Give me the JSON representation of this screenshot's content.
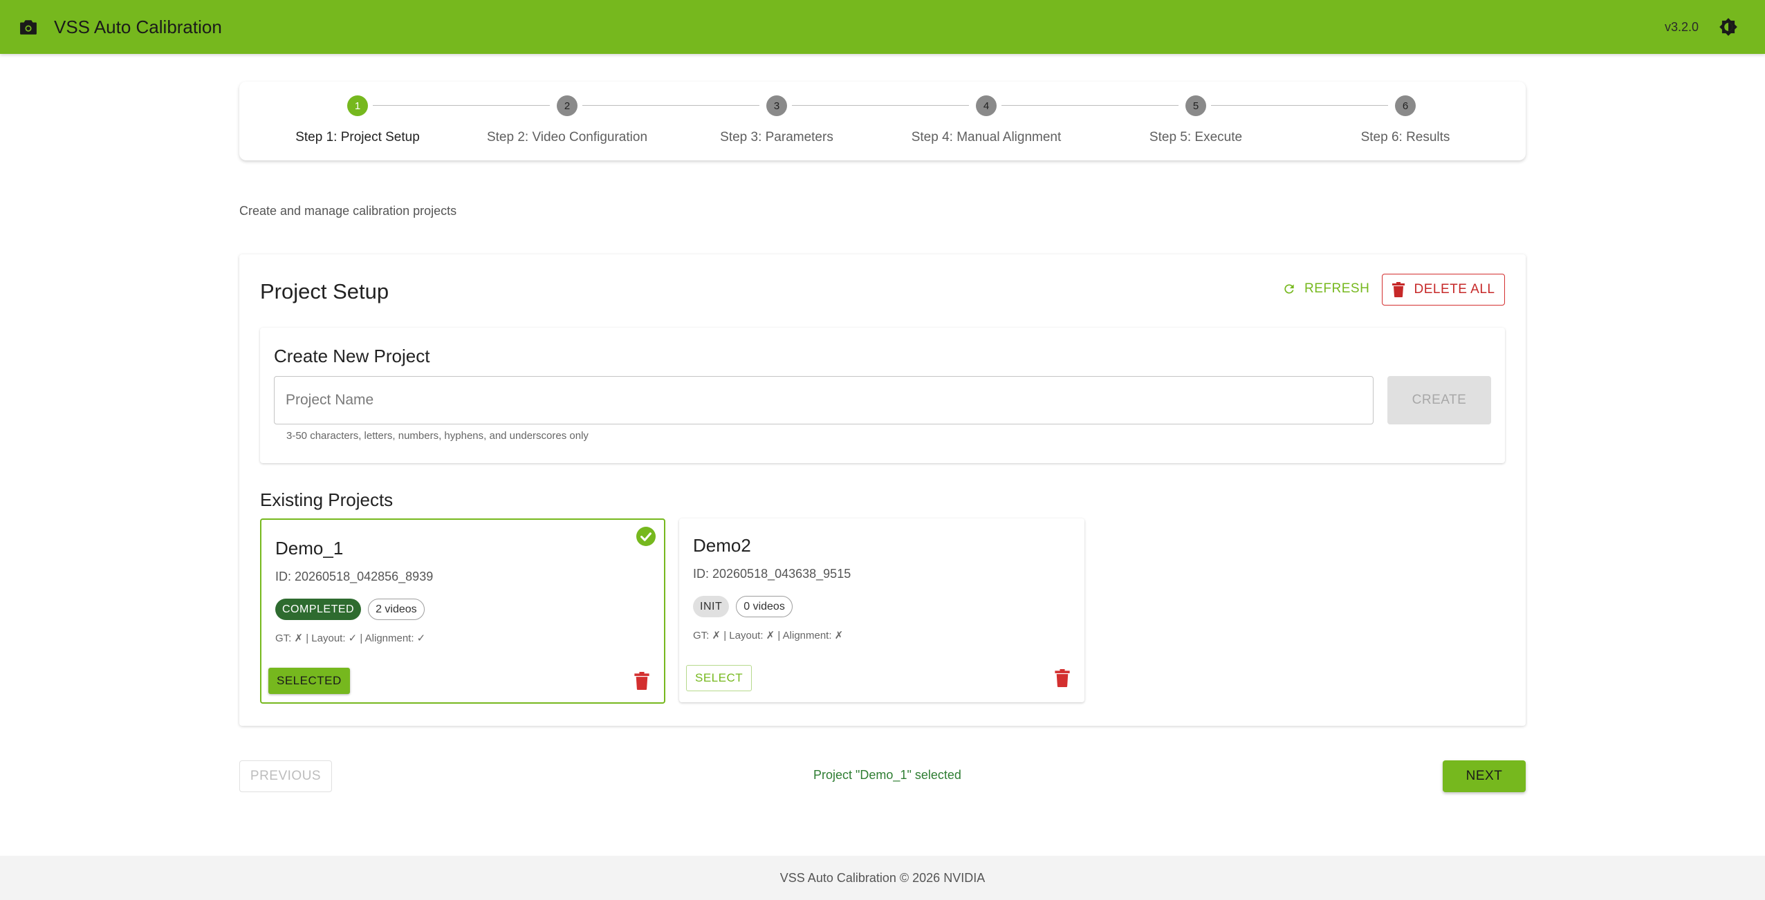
{
  "app": {
    "title": "VSS Auto Calibration",
    "version": "v3.2.0",
    "icons": {
      "logo": "camera-icon",
      "theme": "brightness-toggle-icon"
    },
    "colors": {
      "primary": "#76b81e",
      "danger": "#d32f2f",
      "completed": "#2e6b2f",
      "success_text": "#2e7d32"
    }
  },
  "stepper": {
    "active_step": 1,
    "steps": [
      {
        "number": "1",
        "label": "Step 1: Project Setup"
      },
      {
        "number": "2",
        "label": "Step 2: Video Configuration"
      },
      {
        "number": "3",
        "label": "Step 3: Parameters"
      },
      {
        "number": "4",
        "label": "Step 4: Manual Alignment"
      },
      {
        "number": "5",
        "label": "Step 5: Execute"
      },
      {
        "number": "6",
        "label": "Step 6: Results"
      }
    ]
  },
  "subtitle": "Create and manage calibration projects",
  "setup": {
    "title": "Project Setup",
    "refresh_label": "REFRESH",
    "delete_all_label": "DELETE ALL",
    "create": {
      "heading": "Create New Project",
      "name_value": "",
      "name_placeholder": "Project Name",
      "create_label": "CREATE",
      "helper": "3-50 characters, letters, numbers, hyphens, and underscores only"
    },
    "existing_heading": "Existing Projects",
    "projects": [
      {
        "name": "Demo_1",
        "id": "ID: 20260518_042856_8939",
        "status": "COMPLETED",
        "videos": "2 videos",
        "flags": "GT: ✗ | Layout: ✓ | Alignment: ✓",
        "button": "SELECTED",
        "selected": true
      },
      {
        "name": "Demo2",
        "id": "ID: 20260518_043638_9515",
        "status": "INIT",
        "videos": "0 videos",
        "flags": "GT: ✗ | Layout: ✗ | Alignment: ✗",
        "button": "SELECT",
        "selected": false
      }
    ]
  },
  "nav": {
    "previous_label": "PREVIOUS",
    "status": "Project \"Demo_1\" selected",
    "next_label": "NEXT"
  },
  "footer": "VSS Auto Calibration © 2026 NVIDIA"
}
